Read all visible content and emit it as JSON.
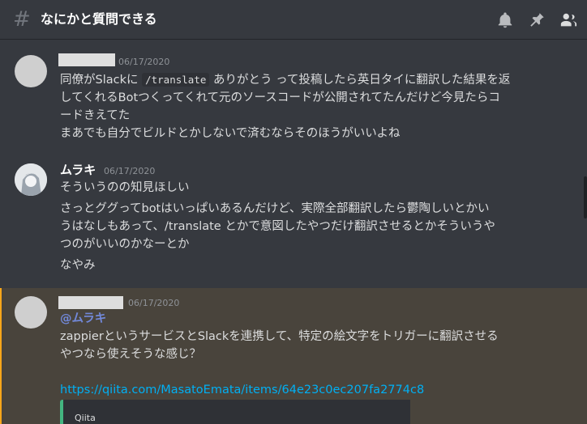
{
  "header": {
    "hash": "#",
    "channel": "なにかと質問できる",
    "icons": [
      "bell-icon",
      "pin-icon",
      "members-icon"
    ]
  },
  "messages": [
    {
      "timestamp": "06/17/2020",
      "line1_a": "同僚がSlackに",
      "line1_code": "/translate",
      "line1_b": "ありがとう",
      "line1_c": "って投稿したら英日タイに翻訳した結果を返",
      "line2": "してくれるBotつくってくれて元のソースコードが公開されてたんだけど今見たらコ",
      "line3": "ードきえてた",
      "line4": "まあでも自分でビルドとかしないで済むならそのほうがいいよね"
    },
    {
      "username": "ムラキ",
      "timestamp": "06/17/2020",
      "line1": "そういうのの知見ほしい",
      "line2": "さっとググってbotはいっぱいあるんだけど、実際全部翻訳したら鬱陶しいとかい",
      "line3": "うはなしもあって、/translate とかで意図したやつだけ翻訳させるとかそういうや",
      "line4": "つのがいいのかなーとか",
      "line5": "なやみ"
    },
    {
      "timestamp": "06/17/2020",
      "mention": "@ムラキ",
      "line1": "zappierというサービスとSlackを連携して、特定の絵文字をトリガーに翻訳させる",
      "line2": "やつなら使えそうな感じ？",
      "link": "https://qiita.com/MasatoEmata/items/64e23c0ec207fa2774c8",
      "embed_provider": "Qiita"
    }
  ],
  "colors": {
    "background": "#36393f",
    "mention_highlight": "#49443c",
    "mention_bar": "#faa61a",
    "link": "#00b0f4",
    "embed_border": "#43b581"
  }
}
